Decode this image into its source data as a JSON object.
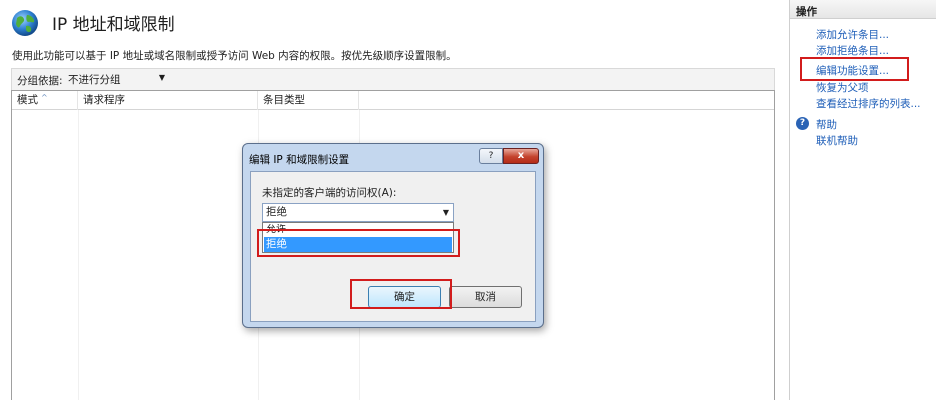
{
  "page": {
    "title": "IP 地址和域限制",
    "description": "使用此功能可以基于 IP 地址或域名限制或授予访问 Web 内容的权限。按优先级顺序设置限制。"
  },
  "toolbar": {
    "group_label": "分组依据:",
    "group_value": "不进行分组"
  },
  "list": {
    "columns": [
      "模式",
      "请求程序",
      "条目类型"
    ]
  },
  "actions": {
    "title": "操作",
    "items": [
      "添加允许条目...",
      "添加拒绝条目...",
      "编辑功能设置...",
      "恢复为父项",
      "查看经过排序的列表...",
      "帮助",
      "联机帮助"
    ]
  },
  "dialog": {
    "title": "编辑 IP 和域限制设置",
    "help_button": "?",
    "close_button": "x",
    "access_label": "未指定的客户端的访问权(A):",
    "access_value": "拒绝",
    "options": [
      "允许",
      "拒绝"
    ],
    "ok_label": "确定",
    "cancel_label": "取消"
  },
  "colors": {
    "link": "#1e5eb8",
    "highlight_box": "#d21c1c",
    "selected_option": "#3399ff",
    "dialog_frame": "#c4d7ee"
  }
}
